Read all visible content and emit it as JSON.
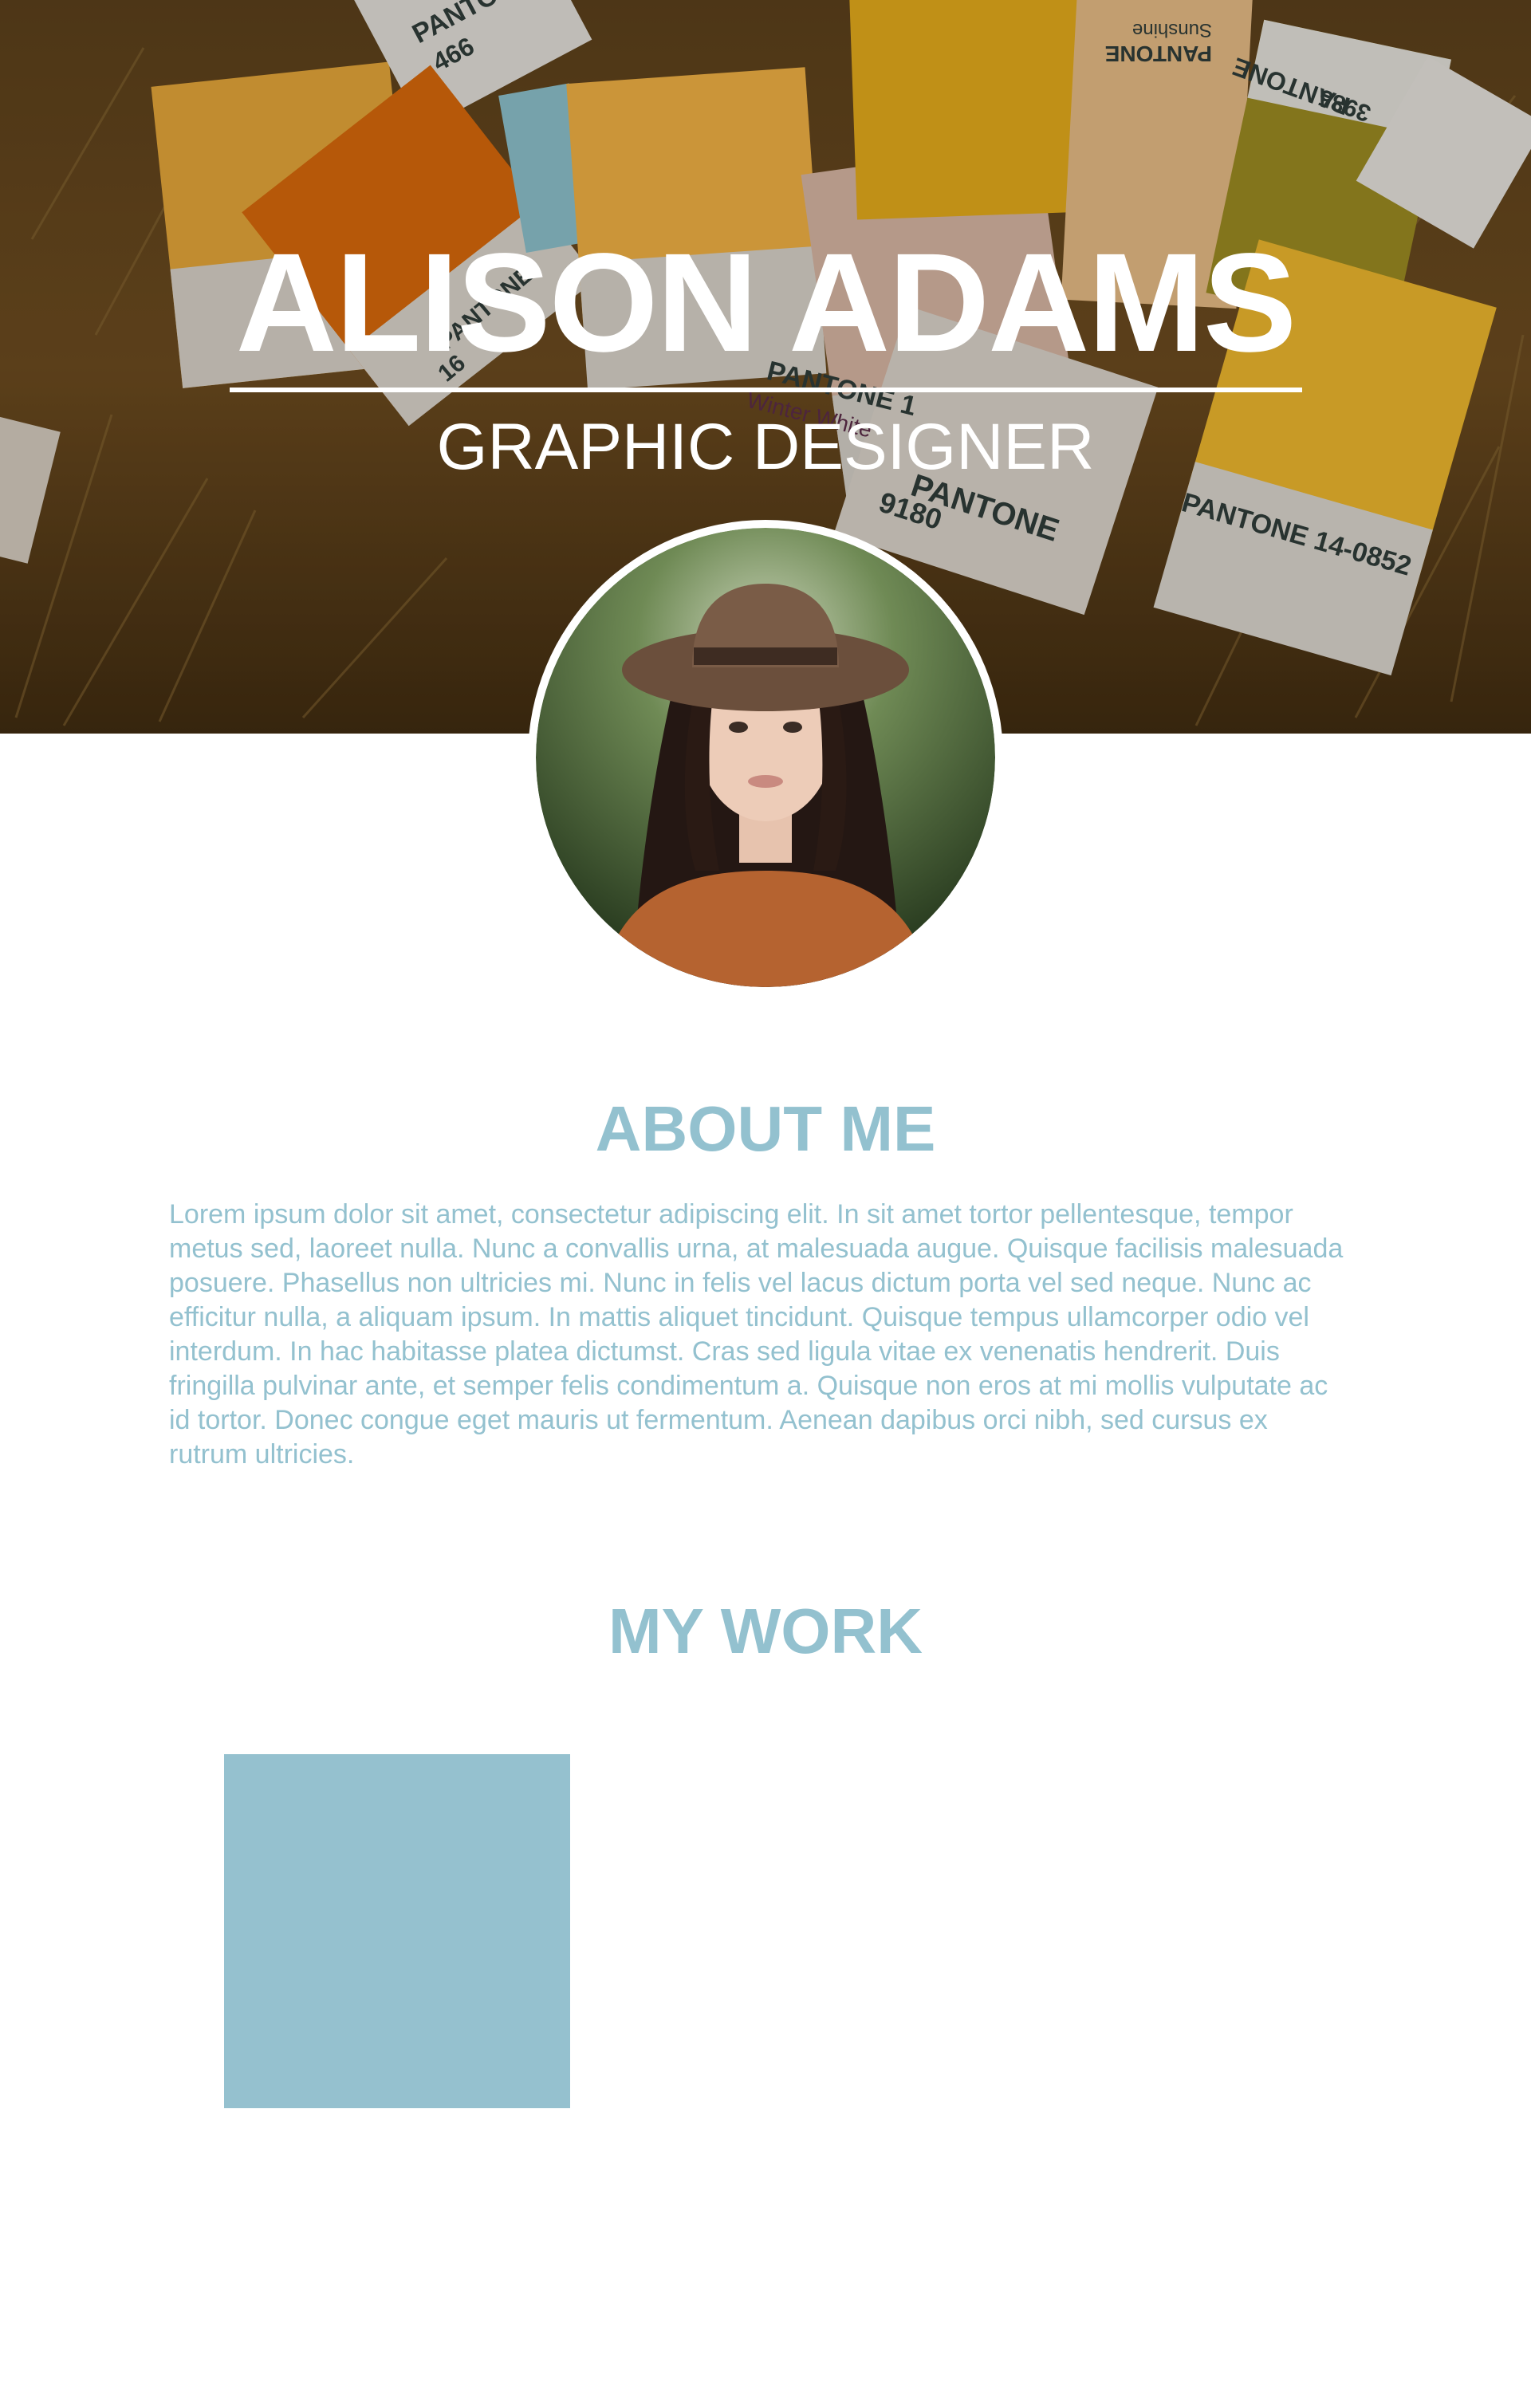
{
  "profile": {
    "name": "ALISON ADAMS",
    "title": "GRAPHIC DESIGNER"
  },
  "about": {
    "heading": "ABOUT ME",
    "body": "Lorem ipsum dolor sit amet, consectetur adipiscing elit. In sit amet tortor pellentesque, tempor metus sed, laoreet nulla. Nunc a convallis urna, at malesuada augue. Quisque facilisis malesuada posuere. Phasellus non ultricies mi. Nunc in felis vel lacus dictum porta vel sed neque. Nunc ac efficitur nulla, a aliquam ipsum. In mattis aliquet tincidunt. Quisque tempus ullamcorper odio vel interdum. In hac habitasse platea dictumst. Cras sed ligula vitae ex venenatis hendrerit. Duis fringilla pulvinar ante, et semper felis condimentum a. Quisque non eros at mi mollis vulputate ac id tortor. Donec congue eget mauris ut fermentum. Aenean dapibus orci nibh, sed cursus ex rutrum ultricies."
  },
  "work": {
    "heading": "MY WORK"
  },
  "hero_photo": {
    "swatch_labels": [
      "PANTONE",
      "466",
      "PANTONE",
      "Sunshine",
      "PANTONE",
      "3985",
      "PANTONE",
      "16",
      "PANTONE 1",
      "Winter White",
      "PANTONE",
      "9180",
      "PANTONE 14-0852"
    ]
  },
  "colors": {
    "accent": "#93c1cf",
    "work_tile": "#95c1cf",
    "text_on_hero": "#ffffff"
  }
}
